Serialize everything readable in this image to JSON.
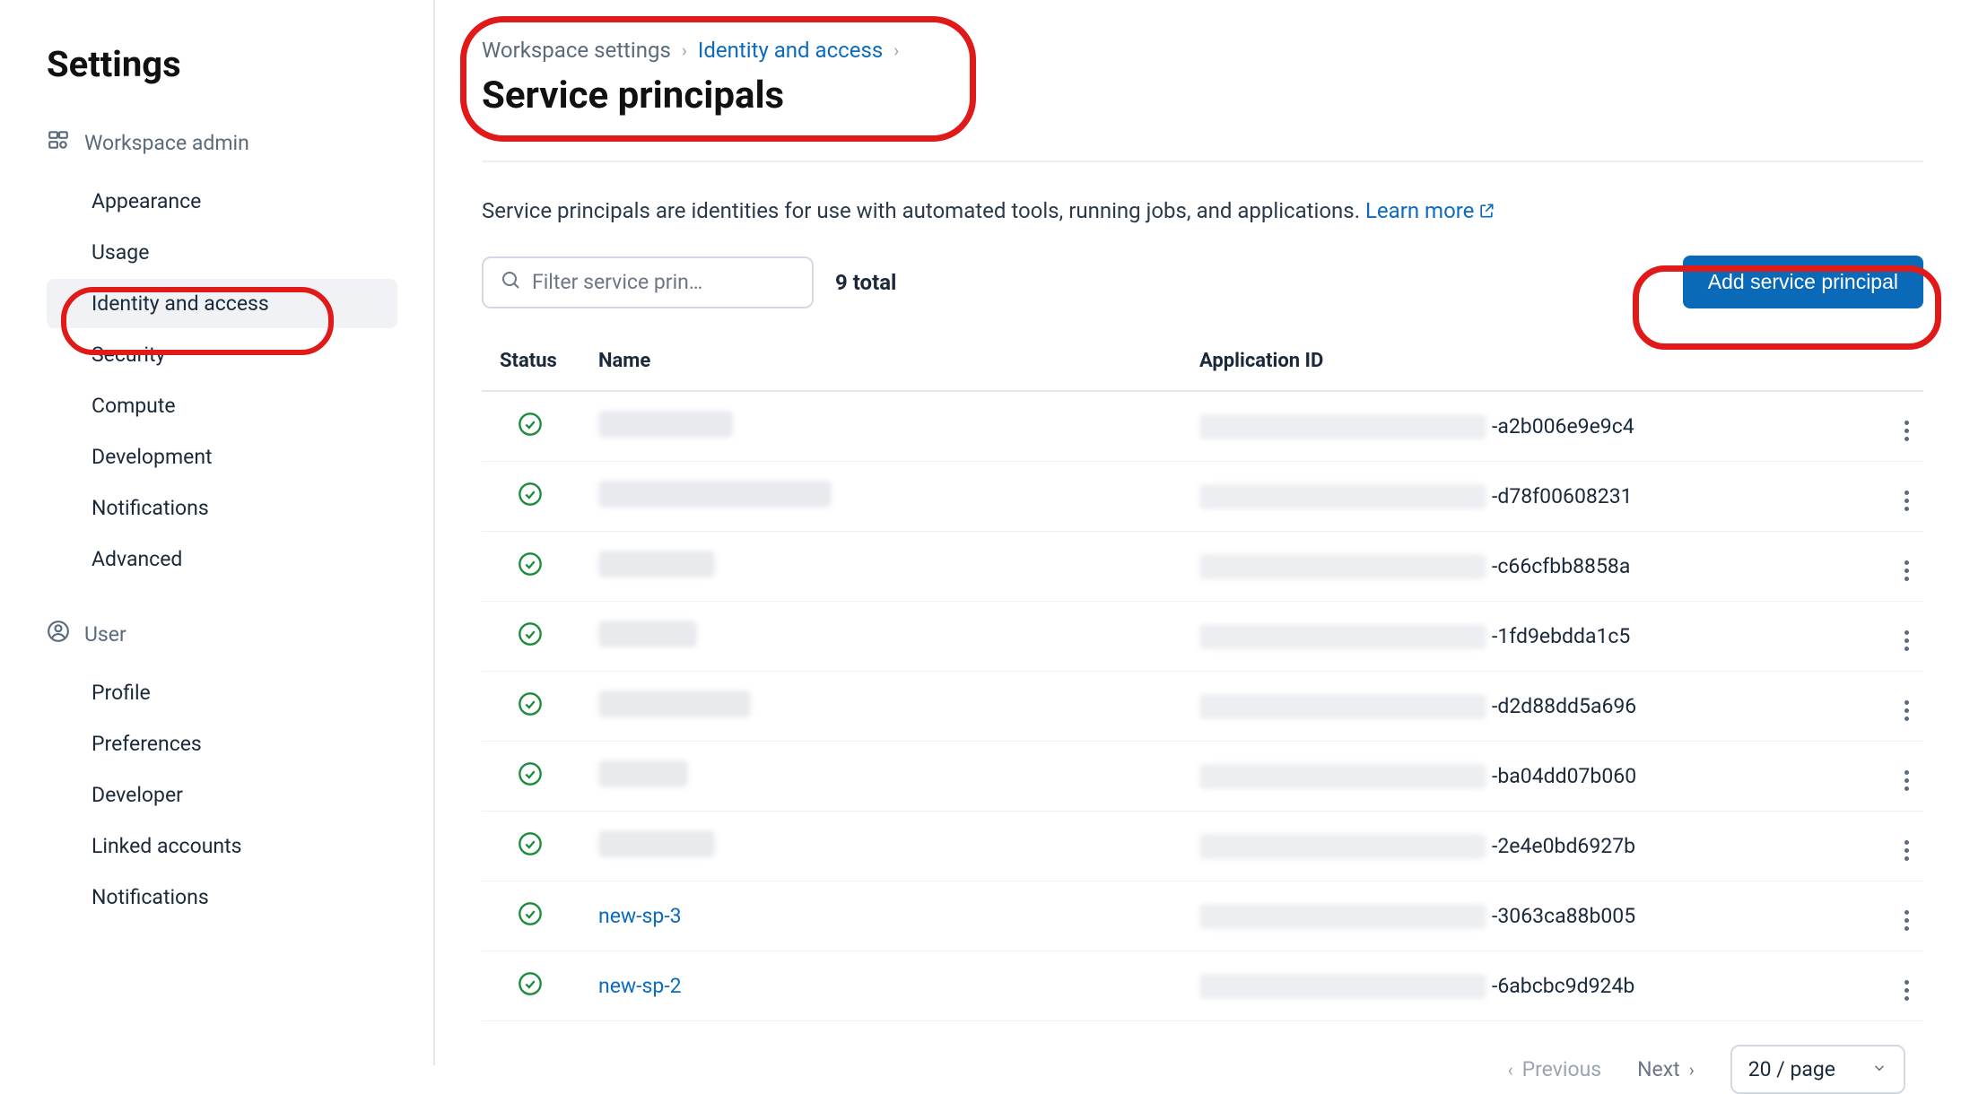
{
  "sidebar": {
    "title": "Settings",
    "sections": [
      {
        "header": "Workspace admin",
        "icon": "workspace-admin-icon",
        "items": [
          {
            "label": "Appearance",
            "active": false
          },
          {
            "label": "Usage",
            "active": false
          },
          {
            "label": "Identity and access",
            "active": true
          },
          {
            "label": "Security",
            "active": false
          },
          {
            "label": "Compute",
            "active": false
          },
          {
            "label": "Development",
            "active": false
          },
          {
            "label": "Notifications",
            "active": false
          },
          {
            "label": "Advanced",
            "active": false
          }
        ]
      },
      {
        "header": "User",
        "icon": "user-icon",
        "items": [
          {
            "label": "Profile",
            "active": false
          },
          {
            "label": "Preferences",
            "active": false
          },
          {
            "label": "Developer",
            "active": false
          },
          {
            "label": "Linked accounts",
            "active": false
          },
          {
            "label": "Notifications",
            "active": false
          }
        ]
      }
    ]
  },
  "breadcrumb": {
    "root": "Workspace settings",
    "mid": "Identity and access"
  },
  "page_title": "Service principals",
  "description": {
    "text": "Service principals are identities for use with automated tools, running jobs, and applications.",
    "learn_more": "Learn more"
  },
  "toolbar": {
    "filter_placeholder": "Filter service prin…",
    "total": "9 total",
    "add_label": "Add service principal"
  },
  "table": {
    "columns": {
      "status": "Status",
      "name": "Name",
      "appid": "Application ID"
    },
    "rows": [
      {
        "status": "active",
        "name_redacted": true,
        "name": "",
        "name_blur_w": 150,
        "appid_prefix_redacted": true,
        "appid_suffix": "-a2b006e9e9c4"
      },
      {
        "status": "active",
        "name_redacted": true,
        "name": "",
        "name_blur_w": 260,
        "appid_prefix_redacted": true,
        "appid_suffix": "-d78f00608231"
      },
      {
        "status": "active",
        "name_redacted": true,
        "name": "",
        "name_blur_w": 130,
        "appid_prefix_redacted": true,
        "appid_suffix": "-c66cfbb8858a"
      },
      {
        "status": "active",
        "name_redacted": true,
        "name": "",
        "name_blur_w": 110,
        "appid_prefix_redacted": true,
        "appid_suffix": "-1fd9ebdda1c5"
      },
      {
        "status": "active",
        "name_redacted": true,
        "name": "",
        "name_blur_w": 170,
        "appid_prefix_redacted": true,
        "appid_suffix": "-d2d88dd5a696"
      },
      {
        "status": "active",
        "name_redacted": true,
        "name": "",
        "name_blur_w": 100,
        "appid_prefix_redacted": true,
        "appid_suffix": "-ba04dd07b060"
      },
      {
        "status": "active",
        "name_redacted": true,
        "name": "",
        "name_blur_w": 130,
        "appid_prefix_redacted": true,
        "appid_suffix": "-2e4e0bd6927b"
      },
      {
        "status": "active",
        "name_redacted": false,
        "name": "new-sp-3",
        "name_blur_w": 0,
        "appid_prefix_redacted": true,
        "appid_suffix": "-3063ca88b005"
      },
      {
        "status": "active",
        "name_redacted": false,
        "name": "new-sp-2",
        "name_blur_w": 0,
        "appid_prefix_redacted": true,
        "appid_suffix": "-6abcbc9d924b"
      }
    ]
  },
  "pager": {
    "previous": "Previous",
    "next": "Next",
    "page_size": "20 / page"
  },
  "annotations": {
    "highlight_nav": true,
    "highlight_header": true,
    "highlight_add_button": true
  }
}
